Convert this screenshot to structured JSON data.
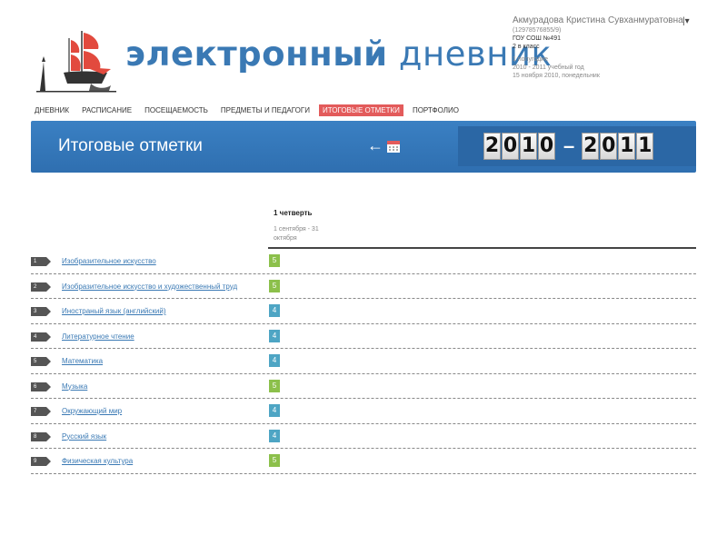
{
  "brand": {
    "part1": "электронный",
    "part2": "дневник"
  },
  "user": {
    "name": "Акмурадова Кристина Сувханмуратовна",
    "phone": "(12978576855/9)",
    "school": "ГОУ СОШ №491",
    "class": "2 в класс",
    "term": "1 полугодие",
    "year": "2010 - 2011 учебный год",
    "date": "15 ноября 2010, понедельник",
    "menu_icon": "|▾"
  },
  "nav": [
    {
      "label": "ДНЕВНИК",
      "active": false
    },
    {
      "label": "РАСПИСАНИЕ",
      "active": false
    },
    {
      "label": "ПОСЕЩАЕМОСТЬ",
      "active": false
    },
    {
      "label": "ПРЕДМЕТЫ И ПЕДАГОГИ",
      "active": false
    },
    {
      "label": "ИТОГОВЫЕ ОТМЕТКИ",
      "active": true
    },
    {
      "label": "ПОРТФОЛИО",
      "active": false
    }
  ],
  "banner": {
    "title": "Итоговые отметки",
    "back_arrow": "←",
    "year_from": "2010",
    "year_to": "2011",
    "dash": "–"
  },
  "quarter": {
    "name": "1 четверть",
    "range": "1 сентября - 31 октября"
  },
  "rows": [
    {
      "n": "1",
      "subject": "Изобразительное искусство",
      "grade": "5"
    },
    {
      "n": "2",
      "subject": "Изобразительное искусство и художественный труд",
      "grade": "5"
    },
    {
      "n": "3",
      "subject": "Иностраный язык (английский)",
      "grade": "4"
    },
    {
      "n": "4",
      "subject": "Литературное чтение",
      "grade": "4"
    },
    {
      "n": "5",
      "subject": "Математика",
      "grade": "4"
    },
    {
      "n": "6",
      "subject": "Музыка",
      "grade": "5"
    },
    {
      "n": "7",
      "subject": "Окружающий мир",
      "grade": "4"
    },
    {
      "n": "8",
      "subject": "Русский язык",
      "grade": "4"
    },
    {
      "n": "9",
      "subject": "Физическая культура",
      "grade": "5"
    }
  ],
  "colors": {
    "brand_blue": "#3a79b4",
    "active_tab": "#e35b5b",
    "grade5": "#8cc04b",
    "grade4": "#4ea5c4"
  }
}
